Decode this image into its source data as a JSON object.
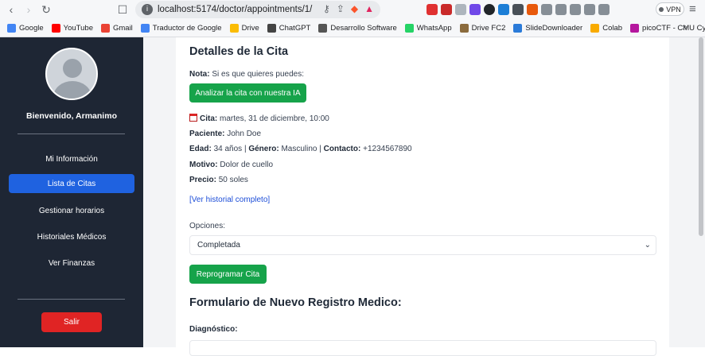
{
  "browser": {
    "url": "localhost:5174/doctor/appointments/1/",
    "vpn_label": "VPN",
    "bookmarks": [
      {
        "label": "Google",
        "color": "#4285f4"
      },
      {
        "label": "YouTube",
        "color": "#ff0000"
      },
      {
        "label": "Gmail",
        "color": "#ea4335"
      },
      {
        "label": "Traductor de Google",
        "color": "#4285f4"
      },
      {
        "label": "Drive",
        "color": "#fbbc04"
      },
      {
        "label": "ChatGPT",
        "color": "#444444"
      },
      {
        "label": "Desarrollo Software",
        "color": "#555555"
      },
      {
        "label": "WhatsApp",
        "color": "#25d366"
      },
      {
        "label": "Drive FC2",
        "color": "#8b6b3d"
      },
      {
        "label": "SlideDownloader",
        "color": "#2b7bd9"
      },
      {
        "label": "Colab",
        "color": "#f9ab00"
      },
      {
        "label": "picoCTF - CMU Cyb...",
        "color": "#b5179e"
      }
    ]
  },
  "sidebar": {
    "welcome": "Bienvenido, Armanimo",
    "items": [
      {
        "label": "Mi Información",
        "active": false
      },
      {
        "label": "Lista de Citas",
        "active": true
      },
      {
        "label": "Gestionar horarios",
        "active": false
      },
      {
        "label": "Historiales Médicos",
        "active": false
      },
      {
        "label": "Ver Finanzas",
        "active": false
      }
    ],
    "logout": "Salir"
  },
  "details": {
    "title": "Detalles de la Cita",
    "note_label": "Nota:",
    "note_text": "Si es que quieres puedes:",
    "analyze_button": "Analizar la cita con nuestra IA",
    "cita_label": "Cita:",
    "cita_value": "martes, 31 de diciembre, 10:00",
    "paciente_label": "Paciente:",
    "paciente_value": "John Doe",
    "edad_label": "Edad:",
    "edad_value": "34 años",
    "genero_label": "Género:",
    "genero_value": "Masculino",
    "contacto_label": "Contacto:",
    "contacto_value": "+1234567890",
    "separator": "|",
    "motivo_label": "Motivo:",
    "motivo_value": "Dolor de cuello",
    "precio_label": "Precio:",
    "precio_value": "50 soles",
    "history_link": "[Ver historial completo]",
    "options_label": "Opciones:",
    "options_selected": "Completada",
    "reschedule_button": "Reprogramar Cita"
  },
  "form": {
    "title": "Formulario de Nuevo Registro Medico:",
    "diagnosis_label": "Diagnóstico:"
  }
}
